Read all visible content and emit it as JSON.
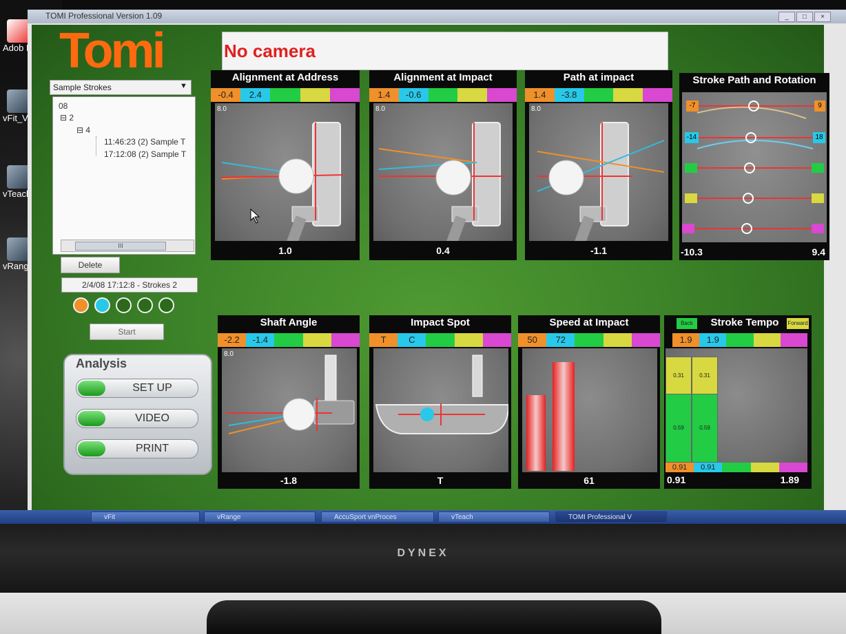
{
  "desktop": {
    "icons": [
      {
        "label": "Adob Reade"
      },
      {
        "label": "vFit_V."
      },
      {
        "label": "vTeach"
      },
      {
        "label": "vRange_"
      }
    ]
  },
  "window": {
    "title": "TOMI Professional Version 1.09"
  },
  "app": {
    "logo": "Tomi",
    "camera_status": "No camera",
    "stroke_dropdown": "Sample Strokes",
    "tree": {
      "root": "08",
      "level1": "2",
      "level2": "4",
      "items": [
        "11:46:23 (2)  Sample T",
        "17:12:08 (2)  Sample T"
      ]
    },
    "scrollbar_thumb": "III",
    "delete_label": "Delete",
    "stroke_info": "2/4/08 17:12:8 - Strokes 2",
    "start_label": "Start",
    "analysis": {
      "header": "Analysis",
      "buttons": [
        "SET UP",
        "VIDEO",
        "PRINT"
      ]
    },
    "colors": {
      "orange": "#f0902a",
      "cyan": "#28c8e8",
      "green": "#22cc44",
      "yellow": "#d8d840",
      "magenta": "#d848d0"
    }
  },
  "panels": {
    "alignment_address": {
      "title": "Alignment at Address",
      "orange": "-0.4",
      "cyan": "2.4",
      "scale": "8.0",
      "value": "1.0"
    },
    "alignment_impact": {
      "title": "Alignment at Impact",
      "orange": "1.4",
      "cyan": "-0.6",
      "scale": "8.0",
      "value": "0.4"
    },
    "path_impact": {
      "title": "Path at impact",
      "orange": "1.4",
      "cyan": "-3.8",
      "scale": "8.0",
      "value": "-1.1"
    },
    "stroke_path": {
      "title": "Stroke Path and Rotation",
      "row1_left": "-7",
      "row1_right": "9",
      "row2_left": "-14",
      "row2_right": "18",
      "min": "-10.3",
      "max": "9.4"
    },
    "shaft_angle": {
      "title": "Shaft Angle",
      "orange": "-2.2",
      "cyan": "-1.4",
      "scale": "8.0",
      "value": "-1.8"
    },
    "impact_spot": {
      "title": "Impact Spot",
      "orange": "T",
      "cyan": "C",
      "value": "T"
    },
    "speed_impact": {
      "title": "Speed at Impact",
      "orange": "50",
      "cyan": "72",
      "value": "61"
    },
    "stroke_tempo": {
      "title": "Stroke Tempo",
      "back": "Back",
      "forward": "Forward",
      "orange": "1.9",
      "cyan": "1.9",
      "bar1_top": "0.31",
      "bar1_bottom": "0.59",
      "bar2_top": "0.31",
      "bar2_bottom": "0.59",
      "low_orange": "0.91",
      "low_cyan": "0.91",
      "left_value": "0.91",
      "right_value": "1.89"
    }
  },
  "taskbar": {
    "items": [
      "vFit",
      "vRange",
      "AccuSport vnProces",
      "vTeach",
      "TOMI Professional V"
    ]
  },
  "monitor": {
    "brand": "DYNEX"
  }
}
